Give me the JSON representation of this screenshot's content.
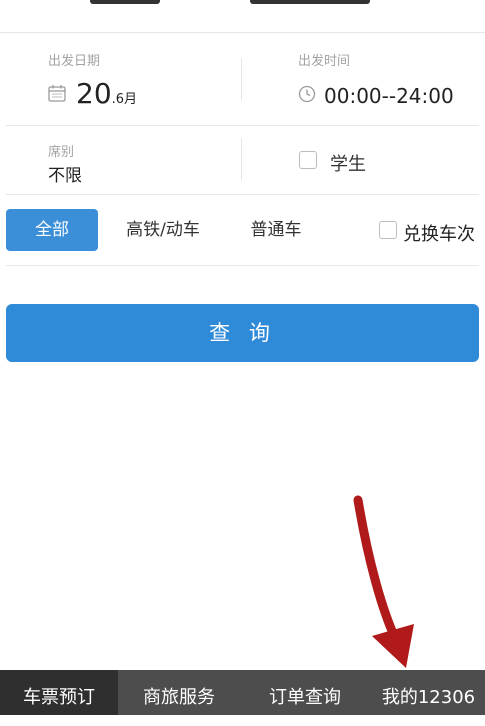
{
  "trip": {
    "date_label": "出发日期",
    "date_day": "20",
    "date_month": ".6月",
    "time_label": "出发时间",
    "time_value": "00:00--24:00"
  },
  "seat": {
    "label": "席别",
    "value": "不限",
    "student_label": "学生"
  },
  "filters": {
    "all": "全部",
    "high_speed": "高铁/动车",
    "normal": "普通车",
    "exchange": "兑换车次"
  },
  "query_button": "查 询",
  "tabs": [
    "车票预订",
    "商旅服务",
    "订单查询",
    "我的12306"
  ],
  "colors": {
    "primary": "#2f8ad8",
    "tab_bar": "#4d4d4d",
    "tab_active": "#2f2f2f",
    "annotation_arrow": "#b11a1a"
  }
}
